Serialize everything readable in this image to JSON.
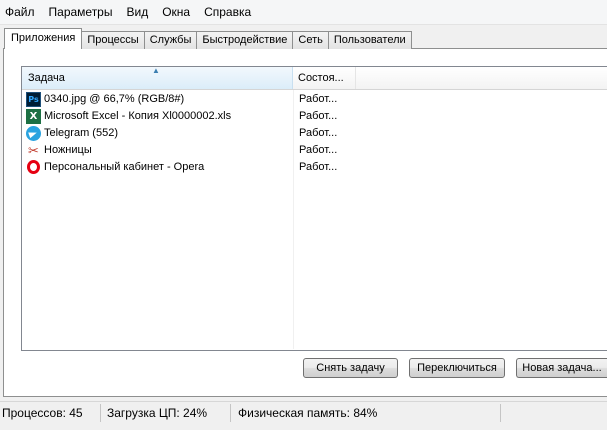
{
  "menu": [
    "Файл",
    "Параметры",
    "Вид",
    "Окна",
    "Справка"
  ],
  "tabs": [
    "Приложения",
    "Процессы",
    "Службы",
    "Быстродействие",
    "Сеть",
    "Пользователи"
  ],
  "active_tab": "Приложения",
  "columns": {
    "task": "Задача",
    "status": "Состоя..."
  },
  "rows": [
    {
      "name": "0340.jpg @ 66,7% (RGB/8#)",
      "status": "Работ...",
      "icon": "photoshop-icon"
    },
    {
      "name": "Microsoft Excel - Копия Xl0000002.xls",
      "status": "Работ...",
      "icon": "excel-icon"
    },
    {
      "name": "Telegram (552)",
      "status": "Работ...",
      "icon": "telegram-icon"
    },
    {
      "name": "Ножницы",
      "status": "Работ...",
      "icon": "scissors-icon"
    },
    {
      "name": "Персональный кабинет - Opera",
      "status": "Работ...",
      "icon": "opera-icon"
    }
  ],
  "buttons": {
    "end_task": "Снять задачу",
    "switch_to": "Переключиться",
    "new_task": "Новая задача..."
  },
  "status": {
    "processes": "Процессов: 45",
    "cpu": "Загрузка ЦП: 24%",
    "memory": "Физическая память: 84%"
  },
  "colors": {
    "header_sort": "#dbedf9",
    "accent": "#3c7fb1"
  }
}
